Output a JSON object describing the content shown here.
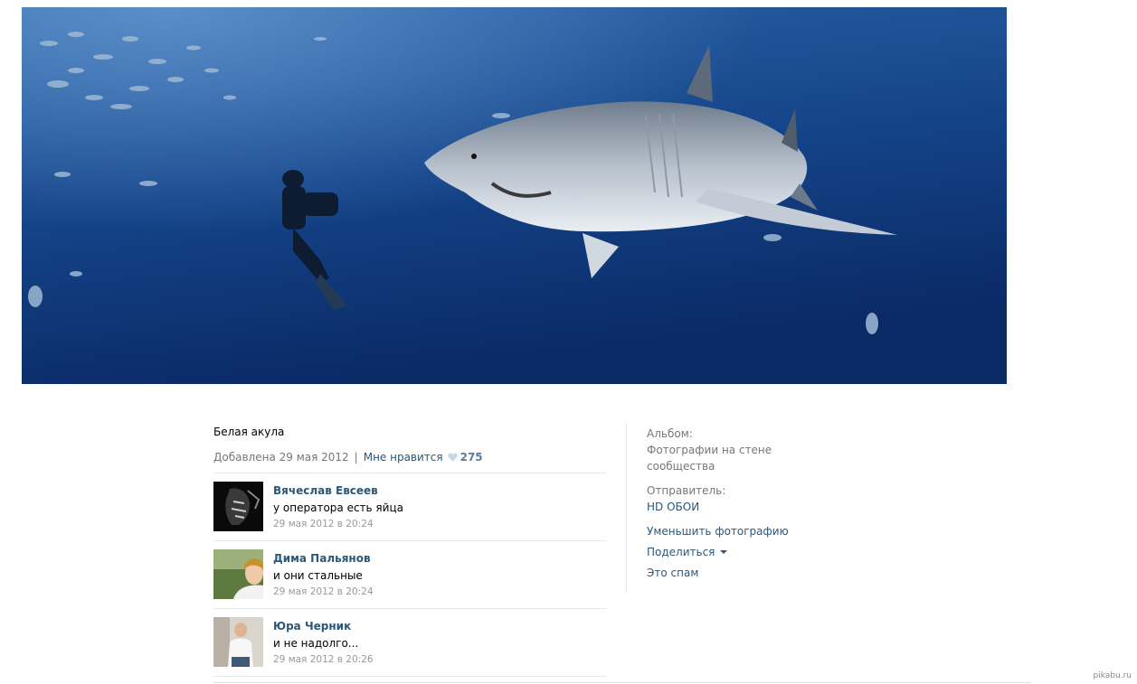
{
  "photo": {
    "description": "Белая акула",
    "added_label": "Добавлена 29 мая 2012",
    "like_label": "Мне нравится",
    "like_count": "275"
  },
  "comments": [
    {
      "author": "Вячеслав Евсеев",
      "text": "у оператора есть яйца",
      "date": "29 мая 2012 в 20:24"
    },
    {
      "author": "Дима Пальянов",
      "text": "и они стальные",
      "date": "29 мая 2012 в 20:24"
    },
    {
      "author": "Юра Черник",
      "text": "и не надолго...",
      "date": "29 мая 2012 в 20:26"
    }
  ],
  "sidebar": {
    "album_label": "Альбом:",
    "album_name": "Фотографии на стене сообщества",
    "sender_label": "Отправитель:",
    "sender_name": "HD ОБОИ",
    "actions": {
      "shrink": "Уменьшить фотографию",
      "share": "Поделиться",
      "spam": "Это спам"
    }
  },
  "watermark": "pikabu.ru",
  "colors": {
    "link": "#2b587a",
    "muted": "#777777",
    "like": "#5b7a9d"
  }
}
